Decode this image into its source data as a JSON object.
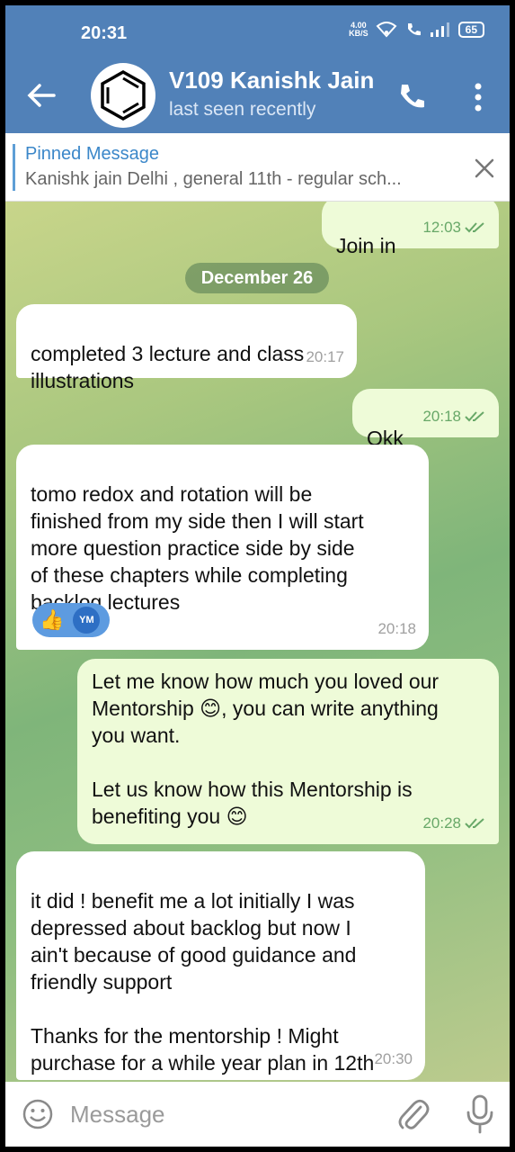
{
  "status_bar": {
    "time": "20:31",
    "net_speed_value": "4.00",
    "net_speed_unit": "KB/S",
    "battery": "65"
  },
  "header": {
    "title": "V109 Kanishk Jain",
    "subtitle": "last seen recently"
  },
  "pinned": {
    "title": "Pinned Message",
    "text": "Kanishk jain  Delhi , general  11th - regular sch..."
  },
  "messages": [
    {
      "direction": "out",
      "text": "Join in",
      "time": "12:03",
      "read": true
    },
    {
      "direction": "date",
      "text": "December 26"
    },
    {
      "direction": "in",
      "text": "completed 3 lecture and class\nillustrations",
      "time": "20:17"
    },
    {
      "direction": "out",
      "text": "Okk",
      "time": "20:18",
      "read": true
    },
    {
      "direction": "in",
      "text": "tomo redox and rotation will be\nfinished from my side then I will start\nmore question practice side by side\nof these chapters while completing\nbacklog lectures",
      "time": "20:18",
      "reaction": {
        "emoji": "thumbs-up",
        "user_initials": "YM"
      }
    },
    {
      "direction": "out",
      "text_line1": "Let me know how much you loved our\nMentorship ",
      "text_line2": ", you can write anything\nyou want.",
      "text_para2": "Let us know how this Mentorship is\nbenefiting you ",
      "time": "20:28",
      "read": true
    },
    {
      "direction": "in",
      "text": "it did ! benefit me a lot initially I was\ndepressed about backlog but now I\nain't because of good guidance and\nfriendly support\n\nThanks for the mentorship ! Might\npurchase for a while year plan in 12th",
      "time": "20:30"
    }
  ],
  "composer": {
    "placeholder": "Message"
  },
  "colors": {
    "header_bg": "#5181b8",
    "out_bubble": "#eefbd8",
    "in_bubble": "#ffffff",
    "read_tick": "#68a868"
  }
}
